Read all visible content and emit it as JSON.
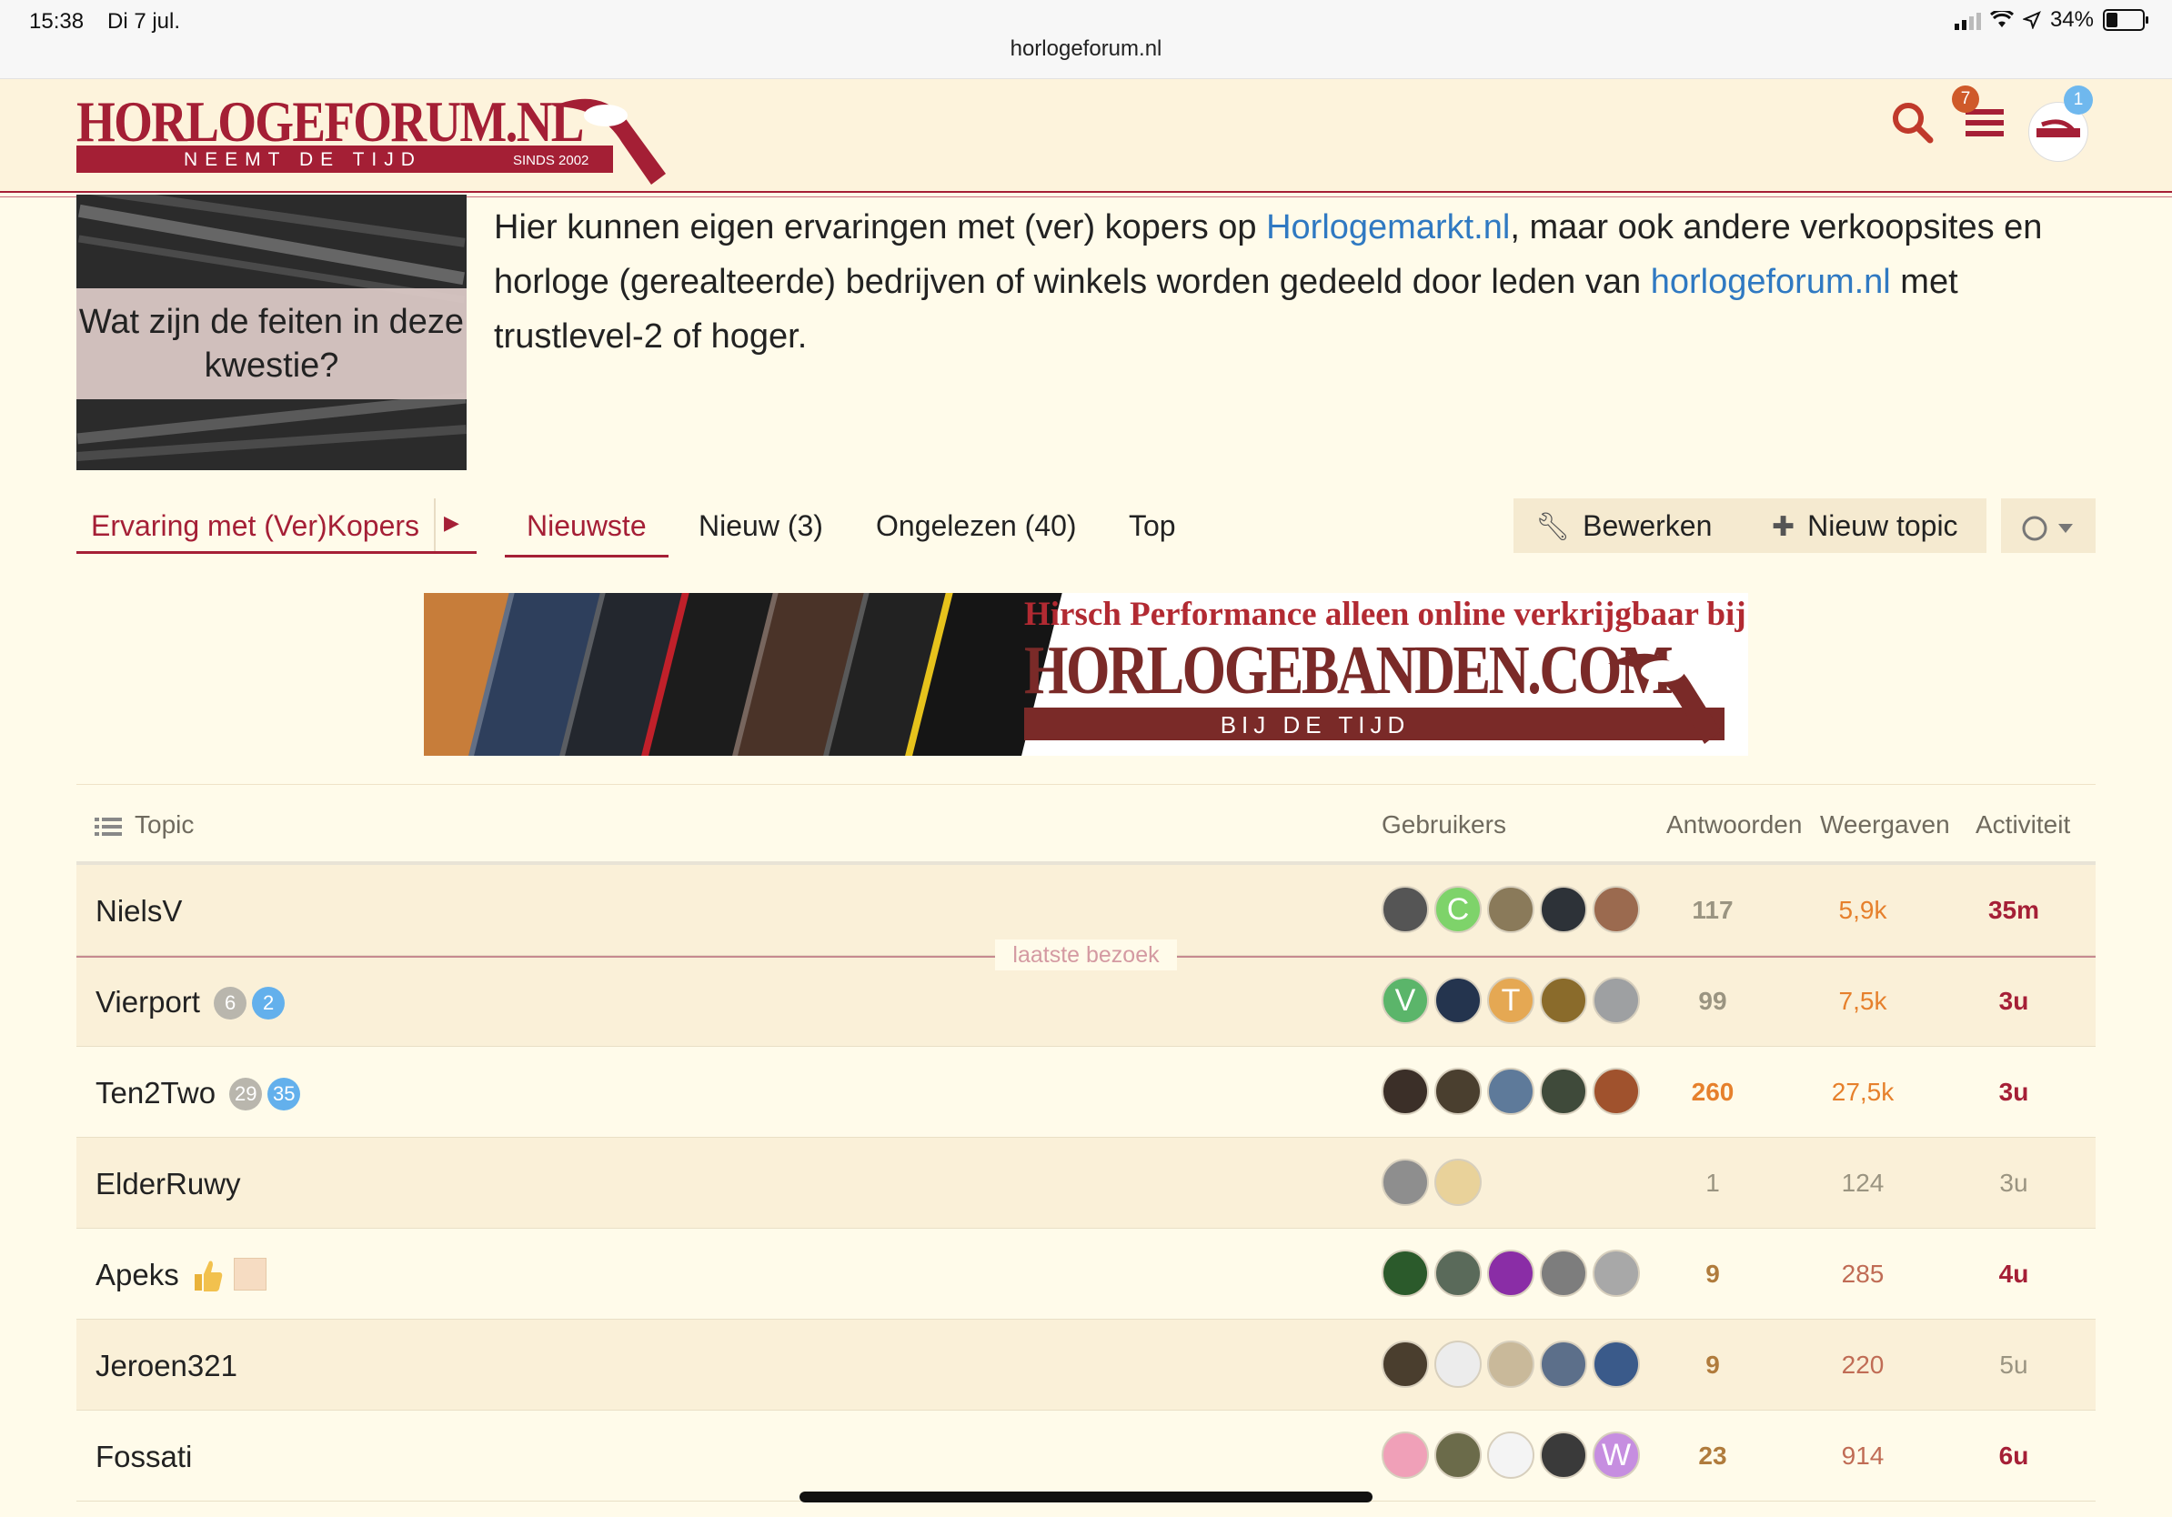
{
  "status_bar": {
    "time": "15:38",
    "date": "Di 7 jul.",
    "battery": "34%",
    "url": "horlogeforum.nl"
  },
  "header": {
    "logo_text": "HORLOGEFORUM.NL",
    "logo_tagline": "NEEMT DE TIJD",
    "logo_since": "SINDS 2002",
    "menu_badge": "7",
    "user_badge": "1",
    "icons": [
      "search-icon",
      "hamburger-icon",
      "avatar"
    ]
  },
  "intro": {
    "image_caption": "Wat zijn de feiten in deze kwestie?",
    "text_1": "Hier kunnen eigen ervaringen met (ver) kopers op ",
    "link_1": "Horlogemarkt.nl",
    "text_2": ", maar ook andere verkoopsites en horloge (gerealteerde) bedrijven of winkels worden gedeeld door leden van ",
    "link_2": "horlogeforum.nl",
    "text_3": " met trustlevel-2 of hoger."
  },
  "nav": {
    "category": "Ervaring met (Ver)Kopers",
    "tabs": [
      "Nieuwste",
      "Nieuw (3)",
      "Ongelezen (40)",
      "Top"
    ],
    "edit_button": "Bewerken",
    "new_topic_button": "Nieuw topic"
  },
  "banner": {
    "headline": "Hirsch Performance alleen online verkrijgbaar bij",
    "brand": "HORLOGEBANDEN.COM",
    "tagline": "BIJ DE TIJD"
  },
  "table": {
    "headers": {
      "topic": "Topic",
      "users": "Gebruikers",
      "replies": "Antwoorden",
      "views": "Weergaven",
      "activity": "Activiteit"
    },
    "last_visit": "laatste bezoek",
    "rows": [
      {
        "title": "NielsV",
        "badges": [],
        "replies": "117",
        "views": "5,9k",
        "activity": "35m"
      },
      {
        "title": "Vierport",
        "badges": [
          "6",
          "2"
        ],
        "replies": "99",
        "views": "7,5k",
        "activity": "3u"
      },
      {
        "title": "Ten2Two",
        "badges": [
          "29",
          "35"
        ],
        "replies": "260",
        "views": "27,5k",
        "activity": "3u"
      },
      {
        "title": "ElderRuwy",
        "badges": [],
        "replies": "1",
        "views": "124",
        "activity": "3u"
      },
      {
        "title": "Apeks",
        "badges": [],
        "replies": "9",
        "views": "285",
        "activity": "4u"
      },
      {
        "title": "Jeroen321",
        "badges": [],
        "replies": "9",
        "views": "220",
        "activity": "5u"
      },
      {
        "title": "Fossati",
        "badges": [],
        "replies": "23",
        "views": "914",
        "activity": "6u"
      }
    ],
    "avatar_letters": {
      "row0": "C",
      "row1a": "V",
      "row1b": "T",
      "row6": "W"
    }
  },
  "colors": {
    "brand": "#a51f36",
    "background": "#fffbea",
    "link": "#2f79c2",
    "badge_blue": "#63b0ec",
    "badge_gray": "#b9b6ad"
  }
}
